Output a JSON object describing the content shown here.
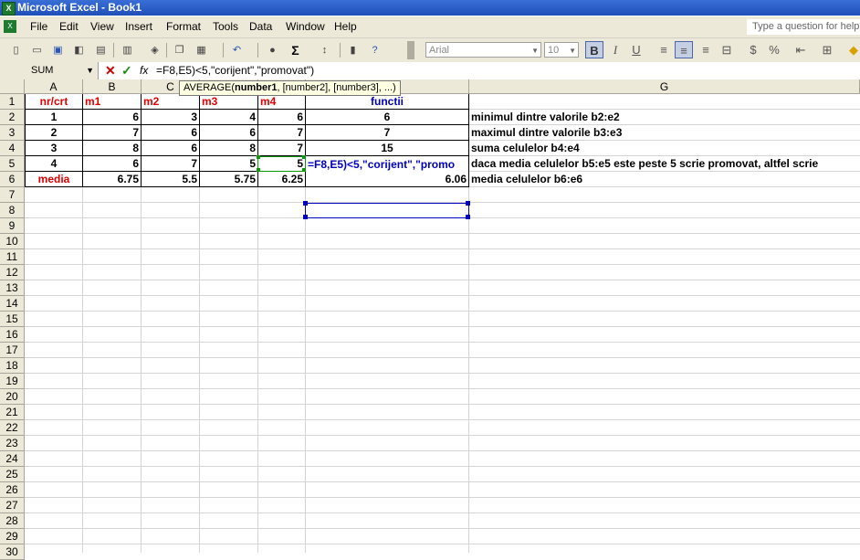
{
  "window": {
    "title": "Microsoft Excel - Book1",
    "app_icon": "excel-icon"
  },
  "menu": {
    "items": [
      "File",
      "Edit",
      "View",
      "Insert",
      "Format",
      "Tools",
      "Data",
      "Window",
      "Help"
    ],
    "ask_placeholder": "Type a question for help"
  },
  "toolbar": {
    "font": "Arial",
    "size": "10",
    "bold": "B",
    "italic": "I",
    "underline": "U",
    "sum": "Σ",
    "currency": "$",
    "percent": "%"
  },
  "formula_bar": {
    "name_box": "SUM",
    "fx": "fx",
    "cancel": "✕",
    "enter": "✓",
    "formula": "=F8,E5)<5,\"corijent\",\"promovat\")"
  },
  "tooltip": {
    "fn": "AVERAGE(",
    "arg1": "number1",
    "rest": ", [number2], [number3], ...)"
  },
  "columns": [
    "A",
    "B",
    "C",
    "",
    "",
    "",
    "G"
  ],
  "rows": [
    "1",
    "2",
    "3",
    "4",
    "5",
    "6",
    "7",
    "8",
    "9",
    "10",
    "11",
    "12",
    "13",
    "14",
    "15",
    "16",
    "17",
    "18",
    "19",
    "20",
    "21",
    "22",
    "23",
    "24",
    "25",
    "26",
    "27",
    "28",
    "29",
    "30"
  ],
  "sheet": {
    "header": {
      "a": "nr/crt",
      "b": "m1",
      "c": "m2",
      "d": "m3",
      "e": "m4",
      "f": "functii"
    },
    "data": [
      {
        "a": "1",
        "b": "6",
        "c": "3",
        "d": "4",
        "e": "6",
        "f": "6",
        "g": "minimul dintre valorile b2:e2"
      },
      {
        "a": "2",
        "b": "7",
        "c": "6",
        "d": "6",
        "e": "7",
        "f": "7",
        "g": "maximul dintre valorile b3:e3"
      },
      {
        "a": "3",
        "b": "8",
        "c": "6",
        "d": "8",
        "e": "7",
        "f": "15",
        "g": "suma celulelor b4:e4"
      },
      {
        "a": "4",
        "b": "6",
        "c": "7",
        "d": "5",
        "e": "5",
        "f": "",
        "g": "daca media celulelor b5:e5 este peste 5 scrie promovat, altfel scrie"
      },
      {
        "a": "media",
        "b": "6.75",
        "c": "5.5",
        "d": "5.75",
        "e": "6.25",
        "f": "6.06",
        "g": "media celulelor b6:e6"
      }
    ],
    "edit_text": "=F8,E5)<5,\"corijent\",\"promo"
  },
  "colors": {
    "header_red": "#e00000",
    "accent_blue": "#0000c0",
    "ref_green": "#0a9a0a"
  }
}
